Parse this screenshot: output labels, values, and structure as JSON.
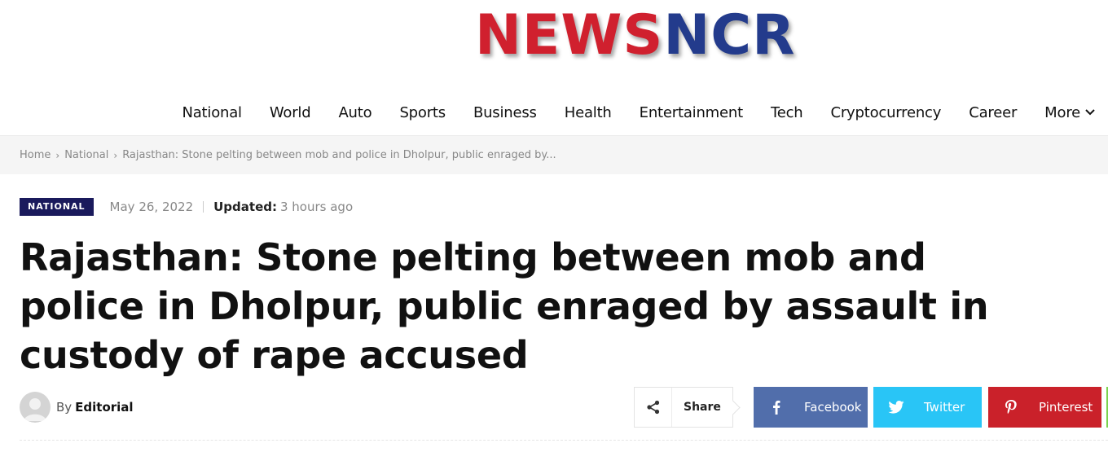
{
  "logo": {
    "part1": "NEWS",
    "part2": "NCR"
  },
  "nav": {
    "items": [
      "National",
      "World",
      "Auto",
      "Sports",
      "Business",
      "Health",
      "Entertainment",
      "Tech",
      "Cryptocurrency",
      "Career"
    ],
    "more_label": "More"
  },
  "breadcrumb": {
    "home": "Home",
    "section": "National",
    "current": "Rajasthan: Stone pelting between mob and police in Dholpur, public enraged by..."
  },
  "article": {
    "category": "NATIONAL",
    "date": "May 26, 2022",
    "updated_label": "Updated:",
    "updated_value": "3 hours ago",
    "title": "Rajasthan: Stone pelting between mob and police in Dholpur, public enraged by assault in custody of rape accused",
    "by_label": "By",
    "author": "Editorial"
  },
  "share": {
    "label": "Share",
    "facebook": "Facebook",
    "twitter": "Twitter",
    "pinterest": "Pinterest"
  },
  "colors": {
    "logo_red": "#d0202e",
    "logo_blue": "#233b8c",
    "badge": "#1a1a5c",
    "facebook": "#516eab",
    "twitter": "#29c5f6",
    "pinterest": "#ca212a"
  },
  "icons": [
    "share-icon",
    "facebook-icon",
    "twitter-icon",
    "pinterest-icon",
    "chevron-down-icon",
    "avatar-icon"
  ]
}
